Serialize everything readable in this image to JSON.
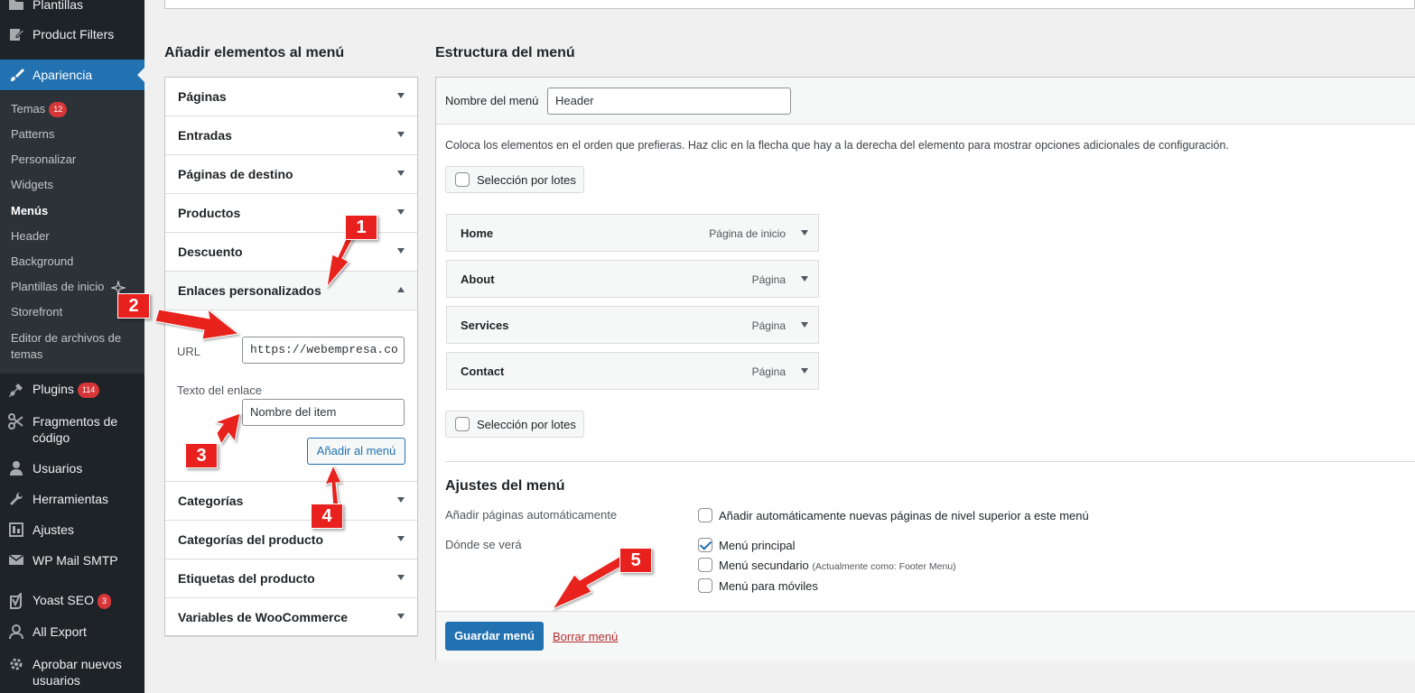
{
  "sidebar": {
    "items_top": [
      {
        "label": "Plantillas",
        "icon": "folder-icon"
      },
      {
        "label": "Product Filters",
        "icon": "edit-icon"
      },
      {
        "label": "Apariencia",
        "icon": "paintbrush-icon"
      }
    ],
    "submenu": [
      {
        "label": "Temas",
        "badge": "12"
      },
      {
        "label": "Patterns"
      },
      {
        "label": "Personalizar"
      },
      {
        "label": "Widgets"
      },
      {
        "label": "Menús"
      },
      {
        "label": "Header"
      },
      {
        "label": "Background"
      },
      {
        "label": "Plantillas de inicio"
      },
      {
        "label": "Storefront"
      },
      {
        "label": "Editor de archivos de"
      },
      {
        "label": "temas"
      }
    ],
    "items_bottom": [
      {
        "label": "Plugins",
        "badge": "114",
        "icon": "plugin-icon"
      },
      {
        "label": "Fragmentos de",
        "icon": "scissors-icon"
      },
      {
        "label": "código"
      },
      {
        "label": "Usuarios",
        "icon": "user-icon"
      },
      {
        "label": "Herramientas",
        "icon": "wrench-icon"
      },
      {
        "label": "Ajustes",
        "icon": "settings-icon"
      },
      {
        "label": "WP Mail SMTP",
        "icon": "mail-icon"
      },
      {
        "label": "Yoast SEO",
        "badge": "3",
        "icon": "yoast-icon"
      },
      {
        "label": "All Export",
        "icon": "export-icon"
      },
      {
        "label": "Aprobar nuevos",
        "icon": "gear-icon"
      },
      {
        "label": "usuarios"
      }
    ]
  },
  "add_items": {
    "title": "Añadir elementos al menú",
    "sections": [
      "Páginas",
      "Entradas",
      "Páginas de destino",
      "Productos",
      "Descuento",
      "Enlaces personalizados"
    ],
    "sections_after": [
      "Categorías",
      "Categorías del producto",
      "Etiquetas del producto",
      "Variables de WooCommerce"
    ],
    "custom_links": {
      "url_label": "URL",
      "url_value": "https://webempresa.co",
      "text_label": "Texto del enlace",
      "text_placeholder": "Nombre del item",
      "add_button": "Añadir al menú"
    }
  },
  "structure": {
    "title": "Estructura del menú",
    "name_label": "Nombre del menú",
    "name_value": "Header",
    "instructions": "Coloca los elementos en el orden que prefieras. Haz clic en la flecha que hay a la derecha del elemento para mostrar opciones adicionales de configuración.",
    "bulk_label": "Selección por lotes",
    "items": [
      {
        "title": "Home",
        "type": "Página de inicio"
      },
      {
        "title": "About",
        "type": "Página"
      },
      {
        "title": "Services",
        "type": "Página"
      },
      {
        "title": "Contact",
        "type": "Página"
      }
    ],
    "settings": {
      "title": "Ajustes del menú",
      "auto_add_label": "Añadir páginas automáticamente",
      "auto_add_option": "Añadir automáticamente nuevas páginas de nivel superior a este menú",
      "location_label": "Dónde se verá",
      "locations": [
        {
          "label": "Menú principal",
          "checked": true,
          "note": ""
        },
        {
          "label": "Menú secundario",
          "checked": false,
          "note": "(Actualmente como: Footer Menu)"
        },
        {
          "label": "Menú para móviles",
          "checked": false,
          "note": ""
        }
      ]
    },
    "save_button": "Guardar menú",
    "delete_link": "Borrar menú"
  },
  "annotations": [
    "1",
    "2",
    "3",
    "4",
    "5"
  ],
  "colors": {
    "accent": "#2271b1",
    "annotation": "#e8201e",
    "sidebar": "#1d2327"
  }
}
